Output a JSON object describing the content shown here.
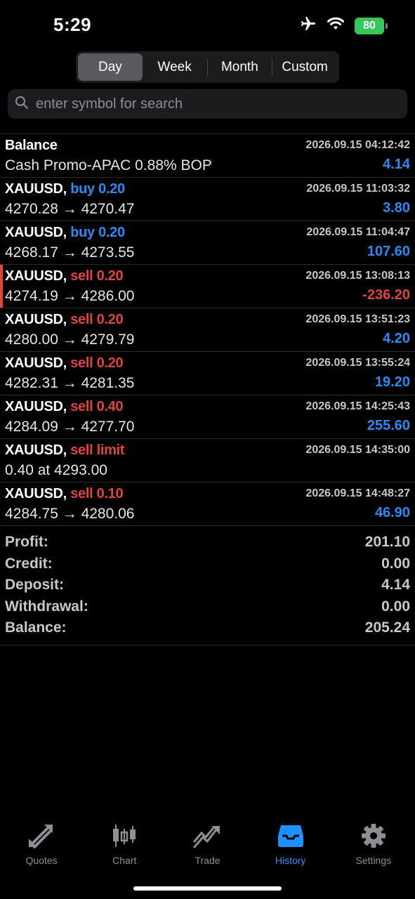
{
  "status": {
    "time": "5:29",
    "battery": "80"
  },
  "period_tabs": [
    {
      "label": "Day",
      "active": true
    },
    {
      "label": "Week",
      "active": false
    },
    {
      "label": "Month",
      "active": false
    },
    {
      "label": "Custom",
      "active": false
    }
  ],
  "search": {
    "placeholder": "enter symbol for search",
    "value": ""
  },
  "rows": [
    {
      "symbol": "Balance",
      "action": "",
      "detail": "Cash Promo-APAC 0.88% BOP",
      "time": "2026.09.15 04:12:42",
      "amount": "4.14"
    },
    {
      "symbol": "XAUUSD,",
      "action": "buy 0.20",
      "detail": "4270.28 → 4270.47",
      "time": "2026.09.15 11:03:32",
      "amount": "3.80"
    },
    {
      "symbol": "XAUUSD,",
      "action": "buy 0.20",
      "detail": "4268.17 → 4273.55",
      "time": "2026.09.15 11:04:47",
      "amount": "107.60"
    },
    {
      "symbol": "XAUUSD,",
      "action": "sell 0.20",
      "detail": "4274.19 → 4286.00",
      "time": "2026.09.15 13:08:13",
      "amount": "-236.20"
    },
    {
      "symbol": "XAUUSD,",
      "action": "sell 0.20",
      "detail": "4280.00 → 4279.79",
      "time": "2026.09.15 13:51:23",
      "amount": "4.20"
    },
    {
      "symbol": "XAUUSD,",
      "action": "sell 0.20",
      "detail": "4282.31 → 4281.35",
      "time": "2026.09.15 13:55:24",
      "amount": "19.20"
    },
    {
      "symbol": "XAUUSD,",
      "action": "sell 0.40",
      "detail": "4284.09 → 4277.70",
      "time": "2026.09.15 14:25:43",
      "amount": "255.60"
    },
    {
      "symbol": "XAUUSD,",
      "action": "sell limit",
      "detail": "0.40 at 4293.00",
      "time": "2026.09.15 14:35:00",
      "amount": ""
    },
    {
      "symbol": "XAUUSD,",
      "action": "sell 0.10",
      "detail": "4284.75 → 4280.06",
      "time": "2026.09.15 14:48:27",
      "amount": "46.90"
    }
  ],
  "summary": [
    {
      "label": "Profit:",
      "value": "201.10"
    },
    {
      "label": "Credit:",
      "value": "0.00"
    },
    {
      "label": "Deposit:",
      "value": "4.14"
    },
    {
      "label": "Withdrawal:",
      "value": "0.00"
    },
    {
      "label": "Balance:",
      "value": "205.24"
    }
  ],
  "tabbar": [
    {
      "label": "Quotes",
      "icon": "quotes-arrows-icon",
      "active": false
    },
    {
      "label": "Chart",
      "icon": "candlestick-chart-icon",
      "active": false
    },
    {
      "label": "Trade",
      "icon": "trade-trend-icon",
      "active": false
    },
    {
      "label": "History",
      "icon": "inbox-tray-icon",
      "active": true
    },
    {
      "label": "Settings",
      "icon": "gear-icon",
      "active": false
    }
  ],
  "colors": {
    "buy": "#2a8af6",
    "sell": "#e0443e",
    "profit": "#2a8af6",
    "loss": "#e0443e",
    "accent": "#1e90ff",
    "inactive": "#8e8e93"
  }
}
